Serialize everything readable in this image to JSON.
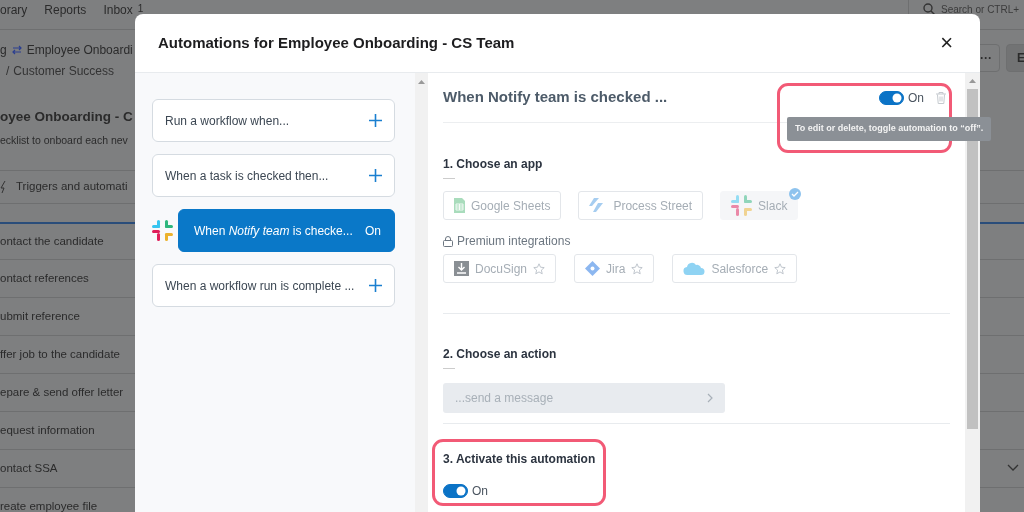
{
  "app_nav": {
    "items": [
      "orary",
      "Reports",
      "Inbox"
    ],
    "inbox_count": "1",
    "search": {
      "placeholder": "Search or CTRL+"
    }
  },
  "breadcrumb": {
    "parent": "g",
    "workflow": "Employee Onboardi",
    "separator": "/",
    "folder": "Customer Success"
  },
  "page": {
    "title": "oyee Onboarding - C",
    "description": "ecklist to onboard each nev",
    "triggers_tab": "Triggers and automati",
    "more_button": "···",
    "edit_button": "E",
    "tasks": [
      {
        "name": "ontact the candidate",
        "selected": true
      },
      {
        "name": "ontact references",
        "selected": false
      },
      {
        "name": "ubmit reference",
        "selected": false
      },
      {
        "name": "ffer job to the candidate",
        "selected": false
      },
      {
        "name": "epare & send offer letter",
        "selected": false
      },
      {
        "name": "equest information",
        "selected": false
      },
      {
        "name": "ontact SSA",
        "selected": false
      },
      {
        "name": "reate employee file",
        "selected": false
      }
    ]
  },
  "modal": {
    "title": "Automations for Employee Onboarding - CS Team",
    "close": "×",
    "triggers": [
      {
        "kind": "add",
        "label": "Run a workflow when...",
        "selected": false
      },
      {
        "kind": "add",
        "label": "When a task is checked then...",
        "selected": false
      },
      {
        "kind": "automation",
        "label": "When *Notify team* is checke...",
        "status": "On",
        "selected": true
      },
      {
        "kind": "add",
        "label": "When a workflow run is complete ...",
        "selected": false
      }
    ],
    "detail": {
      "title": "When Notify team is checked ...",
      "toggle": {
        "on": true,
        "label": "On"
      },
      "tooltip": "To edit or delete, toggle automation to “off”.",
      "step1": {
        "heading": "1. Choose an app",
        "apps": [
          {
            "name": "Google Sheets",
            "selected": false
          },
          {
            "name": "Process Street",
            "selected": false
          },
          {
            "name": "Slack",
            "selected": true
          }
        ],
        "premium_label": "Premium integrations",
        "premium_apps": [
          {
            "name": "DocuSign"
          },
          {
            "name": "Jira"
          },
          {
            "name": "Salesforce"
          }
        ]
      },
      "step2": {
        "heading": "2. Choose an action",
        "action": "...send a message"
      },
      "step3": {
        "heading": "3. Activate this automation",
        "toggle": {
          "on": true,
          "label": "On"
        }
      }
    }
  }
}
